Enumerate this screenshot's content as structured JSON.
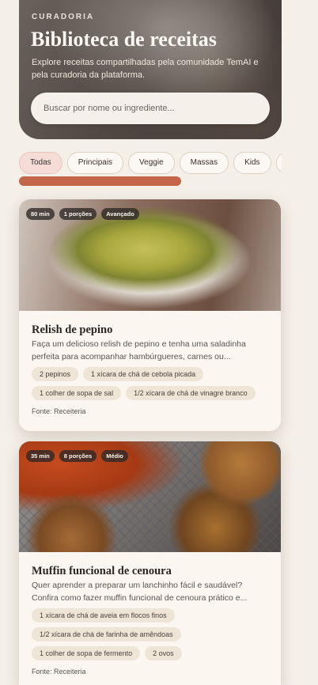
{
  "hero": {
    "eyebrow": "CURADORIA",
    "title": "Biblioteca de receitas",
    "subtitle": "Explore receitas compartilhadas pela comunidade TemAI e pela curadoria da plataforma.",
    "search_placeholder": "Buscar por nome ou ingrediente..."
  },
  "filters": [
    {
      "label": "Todas",
      "active": true
    },
    {
      "label": "Principais",
      "active": false
    },
    {
      "label": "Veggie",
      "active": false
    },
    {
      "label": "Massas",
      "active": false
    },
    {
      "label": "Kids",
      "active": false
    },
    {
      "label": "",
      "active": false
    }
  ],
  "recipes": [
    {
      "time": "80 min",
      "portions": "1 porções",
      "difficulty": "Avançado",
      "title": "Relish de pepino",
      "description": "Faça um delicioso relish de pepino e tenha uma saladinha perfeita para acompanhar hambúrgueres, carnes ou...",
      "ingredients": [
        "2 pepinos",
        "1 xícara de chá de cebola picada",
        "1 colher de sopa de sal",
        "1/2 xícara de chá de vinagre branco"
      ],
      "source": "Fonte: Receiteria"
    },
    {
      "time": "35 min",
      "portions": "8 porções",
      "difficulty": "Médio",
      "title": "Muffin funcional de cenoura",
      "description": "Quer aprender a preparar um lanchinho fácil e saudável? Confira como fazer muffin funcional de cenoura prático e...",
      "ingredients": [
        "1 xícara de chá de aveia em flocos finos",
        "1/2 xícara de chá de farinha de amêndoas",
        "1 colher de sopa de fermento",
        "2 ovos"
      ],
      "source": "Fonte: Receiteria"
    }
  ]
}
